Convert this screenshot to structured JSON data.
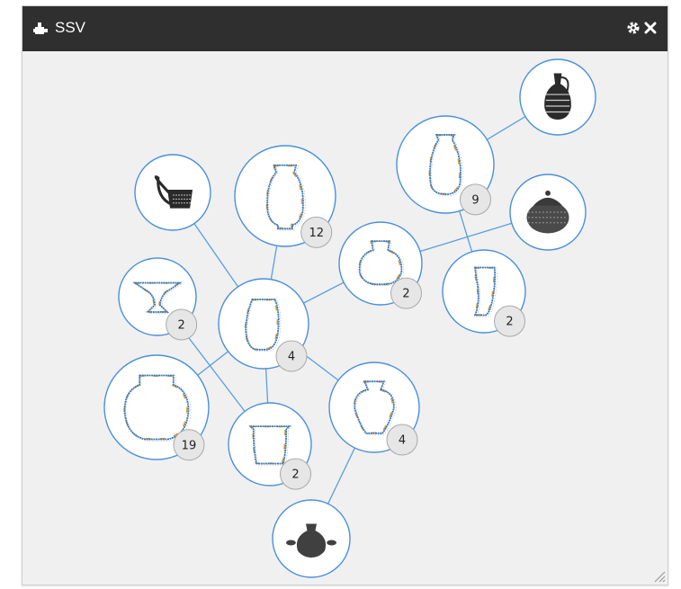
{
  "window": {
    "title": "SSV",
    "title_icon": "puzzle-piece-icon",
    "settings_icon": "gear-icon",
    "close_icon": "close-icon",
    "resize_icon": "resize-grip-icon"
  },
  "colors": {
    "titlebar": "#2f2f2f",
    "background": "#f0f0f0",
    "node_border": "#4a90d9",
    "edge": "#5a9ee0",
    "outline_blue": "#3a78b5",
    "outline_orange": "#e0a13a",
    "badge_fill": "#e6e6e6"
  },
  "nodes": [
    {
      "id": "n1",
      "kind": "photo",
      "shape": "oinochoe"
    },
    {
      "id": "n2",
      "kind": "outline",
      "shape": "tall-slender",
      "count": "9"
    },
    {
      "id": "n3",
      "kind": "photo",
      "shape": "lidded-jar"
    },
    {
      "id": "n4",
      "kind": "photo",
      "shape": "mug"
    },
    {
      "id": "n5",
      "kind": "outline",
      "shape": "tall-amphora",
      "count": "12"
    },
    {
      "id": "n6",
      "kind": "outline",
      "shape": "squat-jar",
      "count": "2"
    },
    {
      "id": "n7",
      "kind": "outline",
      "shape": "narrow-jar",
      "count": "2"
    },
    {
      "id": "n8",
      "kind": "outline",
      "shape": "kylix",
      "count": "2"
    },
    {
      "id": "n9",
      "kind": "outline",
      "shape": "jug",
      "count": "4"
    },
    {
      "id": "n10",
      "kind": "outline",
      "shape": "round-jar",
      "count": "19"
    },
    {
      "id": "n11",
      "kind": "outline",
      "shape": "beaker",
      "count": "2"
    },
    {
      "id": "n12",
      "kind": "outline",
      "shape": "hydria",
      "count": "4"
    },
    {
      "id": "n13",
      "kind": "photo",
      "shape": "small-amphora"
    }
  ],
  "edges": [
    [
      "n1",
      "n2"
    ],
    [
      "n2",
      "n7"
    ],
    [
      "n3",
      "n6"
    ],
    [
      "n6",
      "n9"
    ],
    [
      "n4",
      "n9"
    ],
    [
      "n5",
      "n9"
    ],
    [
      "n8",
      "n11"
    ],
    [
      "n9",
      "n10"
    ],
    [
      "n9",
      "n11"
    ],
    [
      "n9",
      "n12"
    ],
    [
      "n12",
      "n13"
    ]
  ]
}
